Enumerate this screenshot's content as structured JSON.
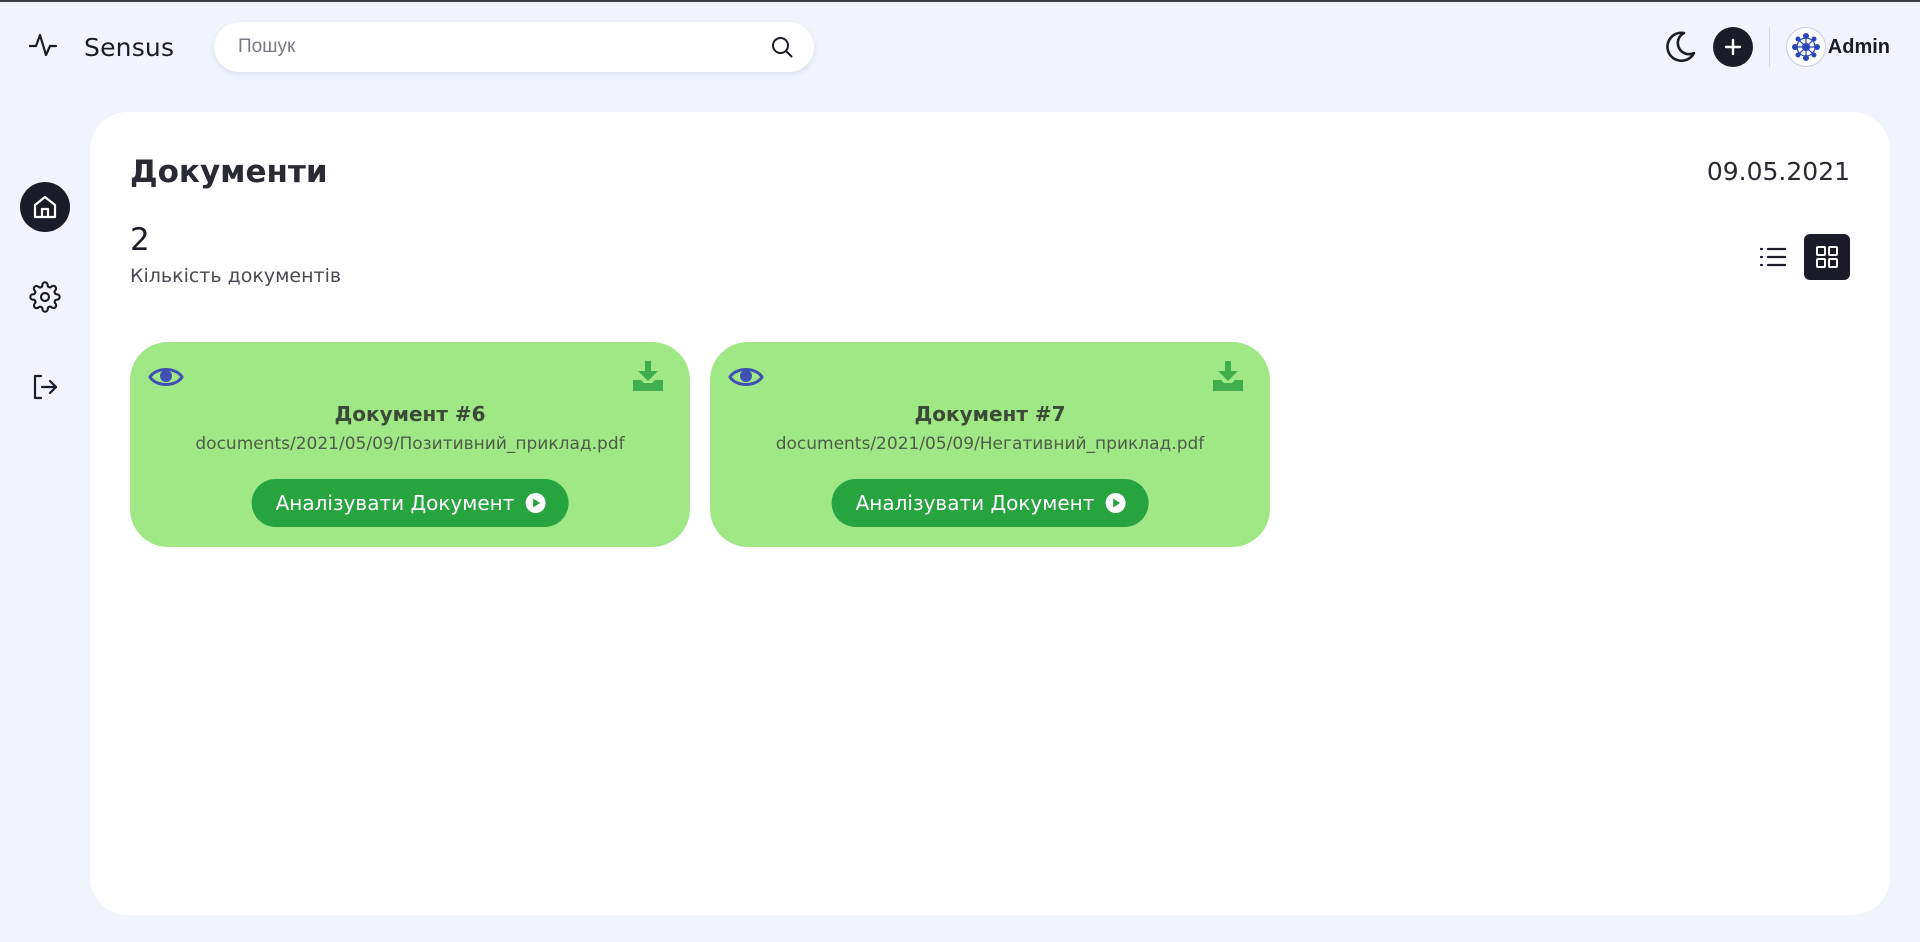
{
  "app": {
    "brand_name": "Sensus",
    "brand_icon": "activity-icon"
  },
  "search": {
    "placeholder": "Пошук",
    "value": "",
    "icon": "search-icon"
  },
  "header": {
    "theme_toggle_icon": "moon-icon",
    "add_icon": "plus-icon",
    "user_name": "Admin",
    "avatar_icon": "avatar-icon"
  },
  "sidebar": {
    "items": [
      {
        "name": "home",
        "icon": "home-icon",
        "active": true
      },
      {
        "name": "settings",
        "icon": "gear-icon",
        "active": false
      },
      {
        "name": "logout",
        "icon": "logout-icon",
        "active": false
      }
    ]
  },
  "main": {
    "title": "Документи",
    "date": "09.05.2021",
    "count": "2",
    "count_label": "Кількість документів",
    "view_modes": [
      {
        "name": "list",
        "icon": "list-icon",
        "active": false
      },
      {
        "name": "grid",
        "icon": "grid-icon",
        "active": true
      }
    ],
    "documents": [
      {
        "title": "Документ #6",
        "path": "documents/2021/05/09/Позитивний_приклад.pdf",
        "button_label": "Аналізувати Документ"
      },
      {
        "title": "Документ #7",
        "path": "documents/2021/05/09/Негативний_приклад.pdf",
        "button_label": "Аналізувати Документ"
      }
    ]
  },
  "colors": {
    "background": "#f1f4fd",
    "panel": "#ffffff",
    "dark": "#1c1c28",
    "card_green": "#a0e886",
    "button_green": "#27a340",
    "download_green": "#3fae4b",
    "eye_blue": "#3f51b5"
  }
}
